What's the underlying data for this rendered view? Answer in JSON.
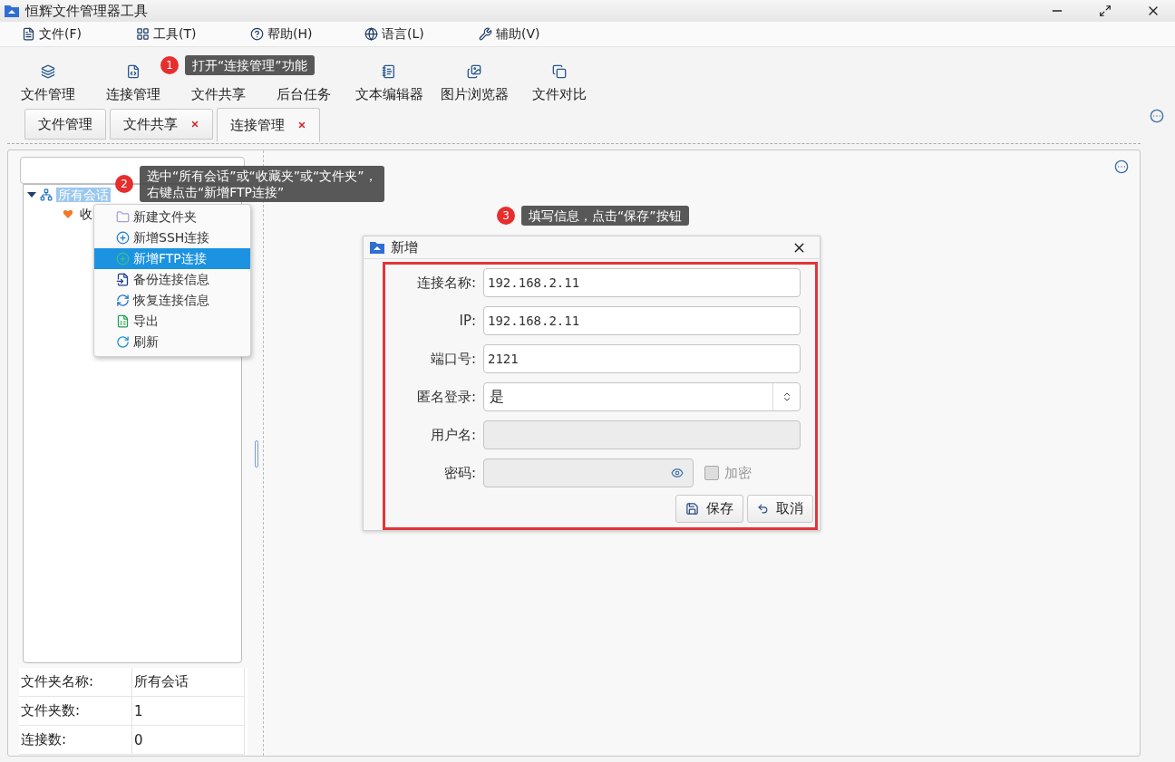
{
  "window": {
    "title": "恒辉文件管理器工具"
  },
  "menu": [
    {
      "label": "文件(F)"
    },
    {
      "label": "工具(T)"
    },
    {
      "label": "帮助(H)"
    },
    {
      "label": "语言(L)"
    },
    {
      "label": "辅助(V)"
    }
  ],
  "toolbar": [
    {
      "label": "文件管理"
    },
    {
      "label": "连接管理"
    },
    {
      "label": "文件共享"
    },
    {
      "label": "后台任务"
    },
    {
      "label": "文本编辑器"
    },
    {
      "label": "图片浏览器"
    },
    {
      "label": "文件对比"
    }
  ],
  "tabs": [
    {
      "label": "文件管理",
      "selected": false,
      "closable": false
    },
    {
      "label": "文件共享",
      "selected": false,
      "closable": true
    },
    {
      "label": "连接管理",
      "selected": true,
      "closable": true
    }
  ],
  "tree": [
    {
      "label": "所有会话",
      "selected": true,
      "expanded": true,
      "children": [
        {
          "label": "收",
          "selected": false
        }
      ]
    }
  ],
  "context_menu": [
    {
      "label": "新建文件夹",
      "selected": false
    },
    {
      "label": "新增SSH连接",
      "selected": false
    },
    {
      "label": "新增FTP连接",
      "selected": true
    },
    {
      "label": "备份连接信息",
      "selected": false
    },
    {
      "label": "恢复连接信息",
      "selected": false
    },
    {
      "label": "导出",
      "selected": false
    },
    {
      "label": "刷新",
      "selected": false
    }
  ],
  "info": [
    {
      "label": "文件夹名称:",
      "value": "所有会话"
    },
    {
      "label": "文件夹数:",
      "value": "1"
    },
    {
      "label": "连接数:",
      "value": "0"
    }
  ],
  "dialog": {
    "title": "新增",
    "fields": [
      {
        "kind": "text",
        "label": "连接名称:",
        "value": "192.168.2.11",
        "disabled": false
      },
      {
        "kind": "text",
        "label": "IP:",
        "value": "192.168.2.11",
        "disabled": false
      },
      {
        "kind": "text",
        "label": "端口号:",
        "value": "2121",
        "disabled": false
      },
      {
        "kind": "select",
        "label": "匿名登录:",
        "value": "是",
        "disabled": false
      },
      {
        "kind": "text",
        "label": "用户名:",
        "disabled": true
      },
      {
        "kind": "password",
        "label": "密码:",
        "disabled": true,
        "checkbox": {
          "label": "加密",
          "checked": false,
          "disabled": true
        }
      }
    ],
    "buttons": [
      {
        "label": "保存"
      },
      {
        "label": "取消"
      }
    ]
  },
  "callouts": [
    {
      "number": "1",
      "lines": [
        "打开“连接管理”功能"
      ]
    },
    {
      "number": "2",
      "lines": [
        "选中“所有会话”或“收藏夹”或“文件夹”，",
        "右键点击“新增FTP连接”"
      ]
    },
    {
      "number": "3",
      "lines": [
        "填写信息，点击“保存”按钮"
      ]
    }
  ]
}
